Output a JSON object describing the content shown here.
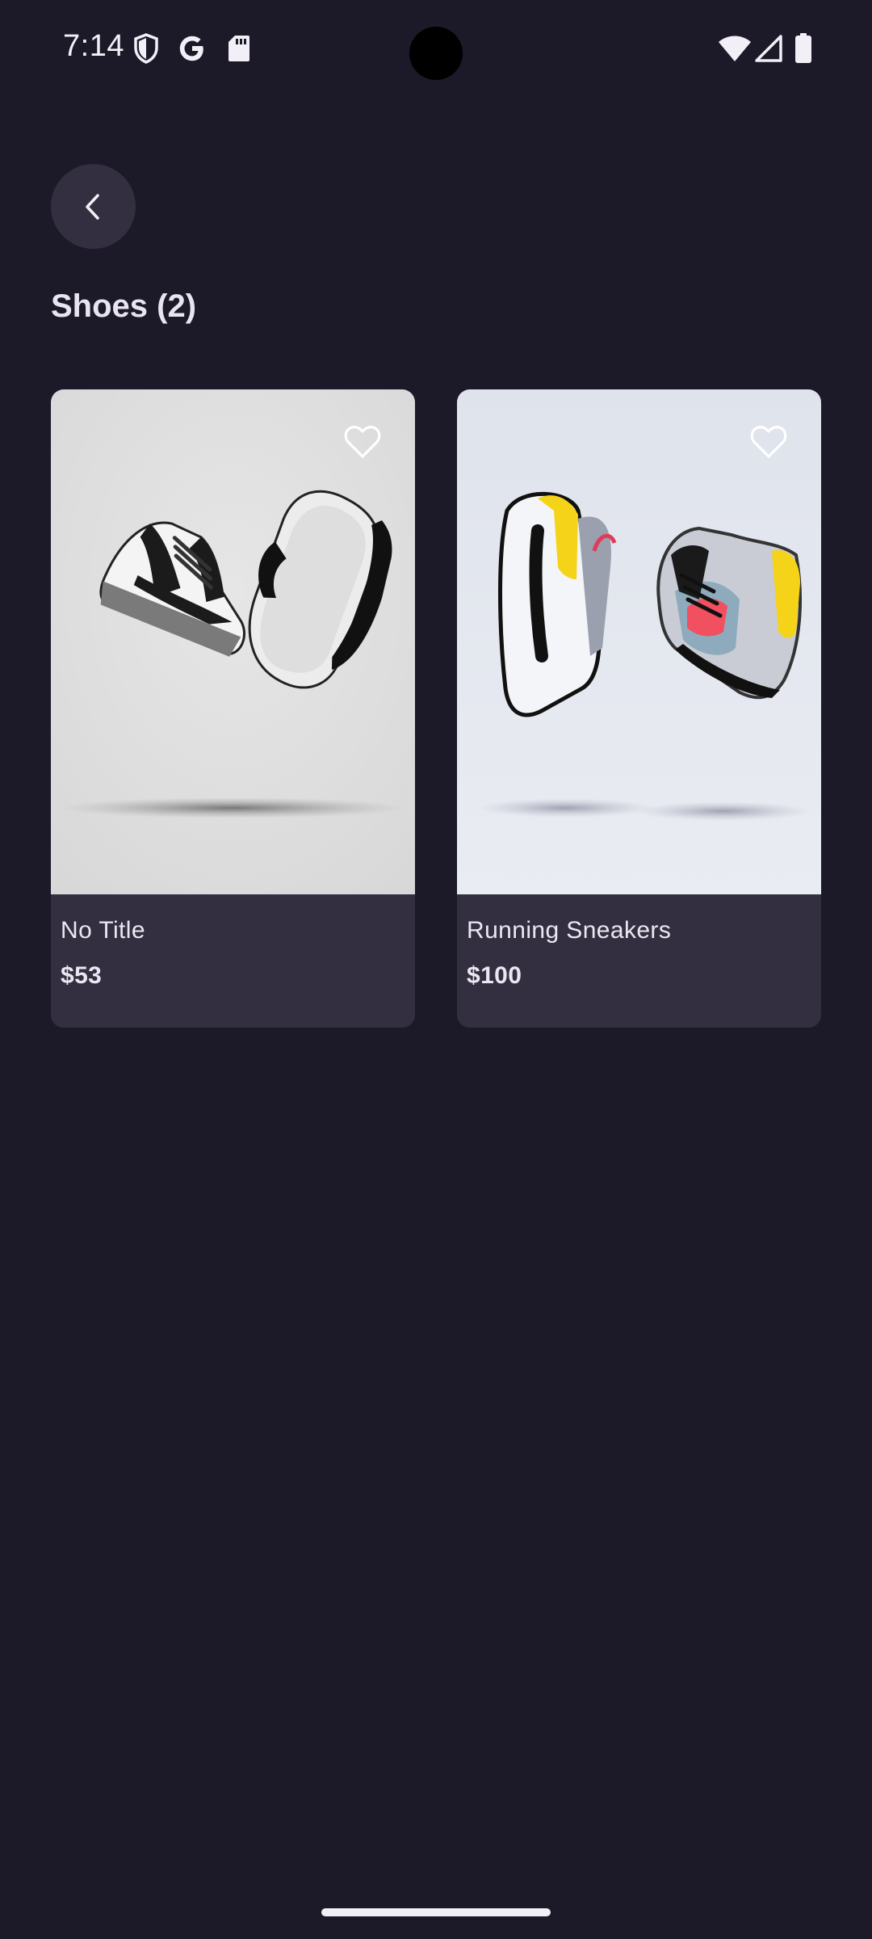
{
  "status_bar": {
    "time": "7:14",
    "left_icons": [
      "shield-icon",
      "google-icon",
      "sd-card-icon"
    ],
    "right_icons": [
      "wifi-icon",
      "cell-signal-icon",
      "battery-icon"
    ]
  },
  "header": {
    "back_icon": "chevron-left-icon",
    "title": "Shoes (2)"
  },
  "products": [
    {
      "title": "No Title",
      "price": "$53",
      "favorite_icon": "heart-outline-icon",
      "image": "black-white-low-top-sneakers"
    },
    {
      "title": "Running Sneakers",
      "price": "$100",
      "favorite_icon": "heart-outline-icon",
      "image": "grey-yellow-running-sneakers"
    }
  ],
  "colors": {
    "background": "#1c1929",
    "surface": "#332f40",
    "text": "#e9e5f0"
  }
}
